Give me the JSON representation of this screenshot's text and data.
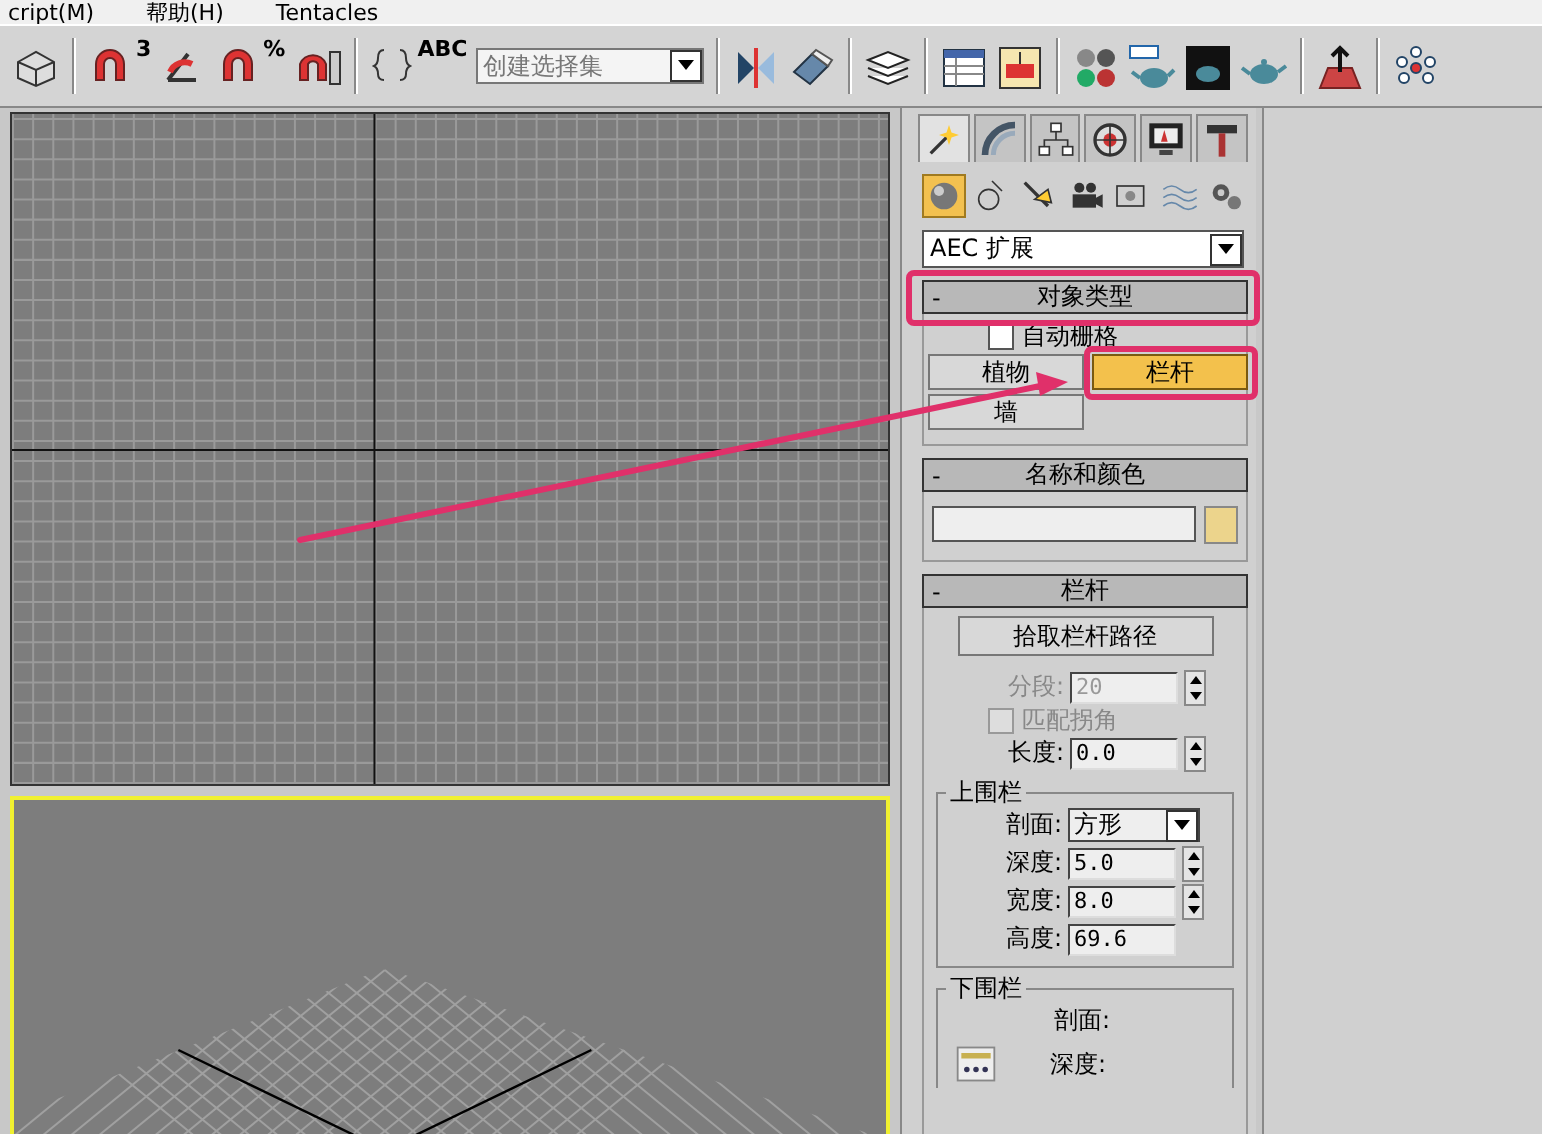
{
  "menu_bar": {
    "items": [
      "cript(M)",
      "帮助(H)",
      "Tentacles"
    ]
  },
  "toolbar": {
    "glyphs": [
      "3",
      "%",
      "ABC"
    ],
    "selection_set": {
      "placeholder": "创建选择集"
    }
  },
  "command_panel": {
    "tabs": [
      {
        "selected": true
      },
      {
        "selected": false
      },
      {
        "selected": false
      },
      {
        "selected": false
      },
      {
        "selected": false
      },
      {
        "selected": false
      }
    ],
    "subtypes": [
      {
        "selected": true
      },
      {
        "selected": false
      },
      {
        "selected": false
      },
      {
        "selected": false
      },
      {
        "selected": false
      },
      {
        "selected": false
      },
      {
        "selected": false
      }
    ],
    "category": "AEC 扩展",
    "object_type": {
      "collapse_mark": "-",
      "title": "对象类型",
      "auto_grid": {
        "label": "自动栅格",
        "checked": false
      },
      "buttons": [
        {
          "label": "植物",
          "selected": false
        },
        {
          "label": "栏杆",
          "selected": true
        },
        {
          "label": "墙",
          "selected": false
        }
      ]
    },
    "name_and_color": {
      "collapse_mark": "-",
      "title": "名称和颜色",
      "color": "#ecd48c"
    },
    "railing": {
      "collapse_mark": "-",
      "title": "栏杆",
      "pick_button": "拾取栏杆路径",
      "segments": {
        "label": "分段:",
        "value": "20",
        "disabled": true
      },
      "match_corners": {
        "label": "匹配拐角",
        "checked": false,
        "disabled": true
      },
      "length": {
        "label": "长度:",
        "value": "0.0"
      },
      "top_rail": {
        "title": "上围栏",
        "profile": {
          "label": "剖面:",
          "value": "方形"
        },
        "depth": {
          "label": "深度:",
          "value": "5.0"
        },
        "width": {
          "label": "宽度:",
          "value": "8.0"
        },
        "height": {
          "label": "高度:",
          "value": "69.6"
        }
      },
      "lower_rail": {
        "title": "下围栏",
        "profile": {
          "label": "剖面:"
        },
        "depth": {
          "label": "深度:"
        }
      }
    }
  }
}
